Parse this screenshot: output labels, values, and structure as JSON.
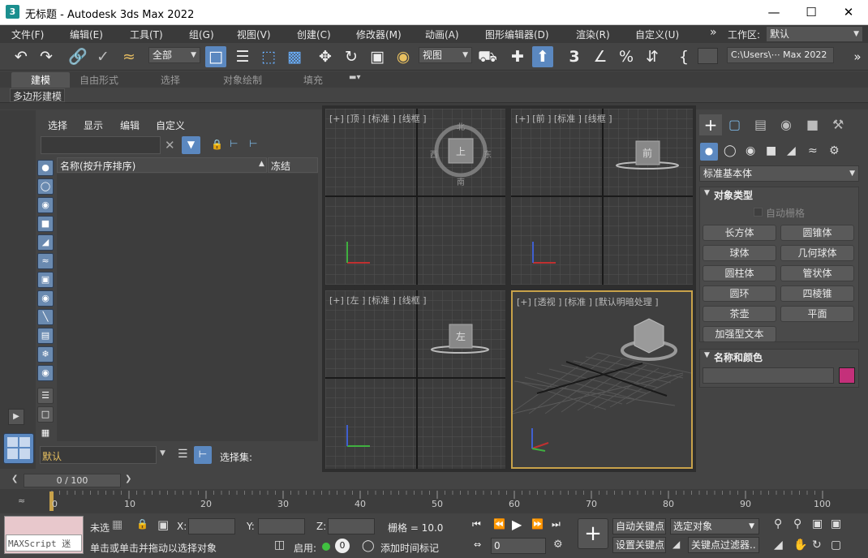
{
  "window": {
    "title": "无标题 - Autodesk 3ds Max 2022",
    "app_icon": "3"
  },
  "menu": {
    "items": [
      "文件(F)",
      "编辑(E)",
      "工具(T)",
      "组(G)",
      "视图(V)",
      "创建(C)",
      "修改器(M)",
      "动画(A)",
      "图形编辑器(D)",
      "渲染(R)",
      "自定义(U)"
    ],
    "more": "»",
    "workspace_label": "工作区:",
    "workspace_value": "默认"
  },
  "toolbar": {
    "selection_filter": "全部",
    "ref_coord": "视图",
    "path": "C:\\Users\\⋯ Max 2022"
  },
  "ribbon": {
    "tabs": [
      "建模",
      "自由形式",
      "选择",
      "对象绘制",
      "填充"
    ],
    "active_tab": "建模",
    "sub_label": "多边形建模"
  },
  "scene_explorer": {
    "menu": [
      "选择",
      "显示",
      "编辑",
      "自定义"
    ],
    "col_name": "名称(按升序排序)",
    "col_sort": "▲",
    "col_freeze": "冻结",
    "layer_value": "默认",
    "selection_set_label": "选择集:"
  },
  "viewports": {
    "top": "[+] [顶 ] [标准 ] [线框 ]",
    "front": "[+] [前 ] [标准 ] [线框 ]",
    "left": "[+] [左 ] [标准 ] [线框 ]",
    "persp": "[+] [透视 ] [标准 ] [默认明暗处理 ]",
    "cube_top": "上",
    "cube_front": "前",
    "cube_left": "左",
    "compass": {
      "n": "北",
      "s": "南",
      "w": "西",
      "e": "东"
    }
  },
  "command_panel": {
    "category": "标准基本体",
    "object_type_title": "对象类型",
    "autogrid": "自动栅格",
    "buttons": [
      "长方体",
      "圆锥体",
      "球体",
      "几何球体",
      "圆柱体",
      "管状体",
      "圆环",
      "四棱锥",
      "茶壶",
      "平面",
      "加强型文本"
    ],
    "name_color_title": "名称和颜色",
    "object_color": "#c4307a"
  },
  "timeline": {
    "frame": "0 / 100",
    "ticks": [
      "0",
      "10",
      "20",
      "30",
      "40",
      "50",
      "60",
      "70",
      "80",
      "90",
      "100"
    ],
    "current": 0,
    "total": 100
  },
  "status": {
    "maxscript": "MAXScript 迷",
    "selection_state": "未选",
    "x_label": "X:",
    "y_label": "Y:",
    "z_label": "Z:",
    "grid": "栅格 = 10.0",
    "prompt": "单击或单击并拖动以选择对象",
    "enable": "启用:",
    "enable_value": "0",
    "add_time_tag": "添加时间标记",
    "auto_key": "自动关键点",
    "set_key": "设置关键点",
    "selected_object": "选定对象",
    "key_filters": "关键点过滤器..",
    "frame_spinner": "0"
  },
  "colors": {
    "accent_blue": "#5b88c0",
    "active_border": "#c8a24a",
    "object_color": "#c4307a"
  }
}
